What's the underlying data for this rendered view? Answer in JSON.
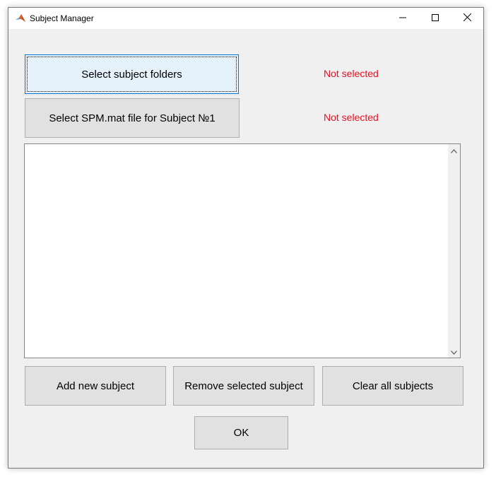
{
  "window": {
    "title": "Subject Manager"
  },
  "buttons": {
    "select_folders": "Select subject folders",
    "select_spm": "Select SPM.mat file for Subject №1",
    "add_subject": "Add new subject",
    "remove_subject": "Remove selected subject",
    "clear_subjects": "Clear all subjects",
    "ok": "OK"
  },
  "status": {
    "folders": "Not selected",
    "spm": "Not selected"
  },
  "subject_list": {
    "items": []
  },
  "colors": {
    "status_red": "#e81123",
    "focus_blue": "#0078d7",
    "button_face": "#e1e1e1"
  },
  "icons": {
    "app": "matlab-icon",
    "minimize": "minimize-icon",
    "maximize": "maximize-icon",
    "close": "close-icon",
    "scroll_up": "chevron-up-icon",
    "scroll_down": "chevron-down-icon"
  }
}
